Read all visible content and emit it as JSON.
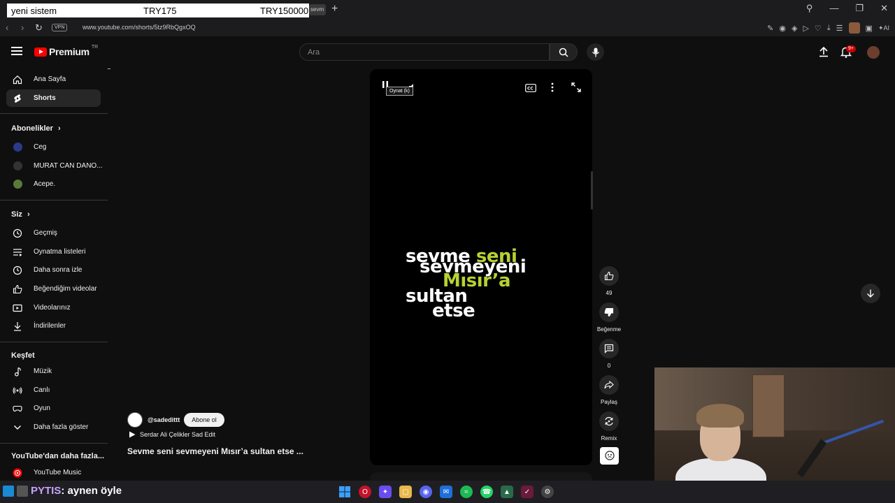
{
  "browser": {
    "overlay_name": "yeni sistem",
    "overlay_price1": "TRY175",
    "overlay_price2": "TRY150000",
    "tab_title": "sevm",
    "url": "www.youtube.com/shorts/5tz9RbQgxOQ",
    "vpn_label": "VPN"
  },
  "header": {
    "brand": "Premium",
    "region": "TR",
    "search_placeholder": "Ara",
    "notification_count": "9+"
  },
  "sidebar": {
    "top_items": [
      {
        "label": "Ana Sayfa",
        "icon": "home-icon"
      },
      {
        "label": "Shorts",
        "icon": "shorts-icon",
        "active": true
      }
    ],
    "subs_heading": "Abonelikler",
    "channels": [
      {
        "label": "Ceg",
        "color": "#2a3a8a"
      },
      {
        "label": "MURAT CAN DANO...",
        "color": "#333333"
      },
      {
        "label": "Acepe.",
        "color": "#5a7a3a"
      }
    ],
    "you_heading": "Siz",
    "you_items": [
      {
        "label": "Geçmiş",
        "icon": "history-icon"
      },
      {
        "label": "Oynatma listeleri",
        "icon": "playlist-icon"
      },
      {
        "label": "Daha sonra izle",
        "icon": "watch-later-icon"
      },
      {
        "label": "Beğendiğim videolar",
        "icon": "like-icon"
      },
      {
        "label": "Videolarınız",
        "icon": "your-videos-icon"
      },
      {
        "label": "İndirilenler",
        "icon": "download-icon"
      }
    ],
    "explore_heading": "Keşfet",
    "explore_items": [
      {
        "label": "Müzik",
        "icon": "music-icon"
      },
      {
        "label": "Canlı",
        "icon": "live-icon"
      },
      {
        "label": "Oyun",
        "icon": "gaming-icon"
      },
      {
        "label": "Daha fazla göster",
        "icon": "chevron-down-icon"
      }
    ],
    "more_heading": "YouTube'dan daha fazla...",
    "more_items": [
      {
        "label": "YouTube Music",
        "icon": "youtube-music-icon"
      }
    ]
  },
  "video": {
    "tooltip": "Oynat (k)",
    "lyrics": {
      "line1_white": "sevme",
      "line1_green": "seni",
      "line2": "sevmeyeni",
      "line3": "Mısır’a",
      "line4": "sultan",
      "line5": "etse"
    },
    "channel_handle": "@sadedittt",
    "subscribe_label": "Abone ol",
    "music": "Serdar Ali Çelikler Sad Edit",
    "title": "Sevme seni sevmeyeni Mısır’a sultan etse ..."
  },
  "actions": {
    "likes": "49",
    "dislike_label": "Beğenme",
    "comments": "0",
    "share_label": "Paylaş",
    "remix_label": "Remix"
  },
  "taskbar": {
    "chat_nick": "PYTIS",
    "chat_message": ": aynen öyle"
  },
  "colors": {
    "accent_red": "#ff0000",
    "lyric_green": "#b6d231",
    "background": "#0f0f0f"
  }
}
